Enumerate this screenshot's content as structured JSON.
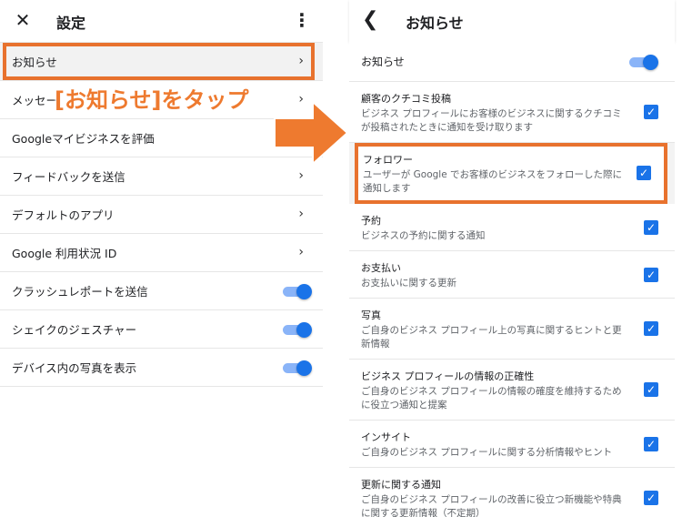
{
  "left": {
    "title": "設定",
    "close_icon": "close-icon",
    "more_icon": "more-vert-icon",
    "rows": [
      {
        "label": "お知らせ",
        "control": "chevron"
      },
      {
        "label": "メッセー",
        "control": "chevron"
      },
      {
        "label": "Googleマイビジネスを評価",
        "control": "none"
      },
      {
        "label": "フィードバックを送信",
        "control": "chevron"
      },
      {
        "label": "デフォルトのアプリ",
        "control": "chevron"
      },
      {
        "label": "Google 利用状況 ID",
        "control": "chevron"
      },
      {
        "label": "クラッシュレポートを送信",
        "control": "toggle-on"
      },
      {
        "label": "シェイクのジェスチャー",
        "control": "toggle-on"
      },
      {
        "label": "デバイス内の写真を表示",
        "control": "toggle-on"
      }
    ],
    "callout": "[お知らせ]をタップ"
  },
  "right": {
    "title": "お知らせ",
    "back_icon": "back-icon",
    "master": {
      "label": "お知らせ",
      "on": true
    },
    "items": [
      {
        "name": "顧客のクチコミ投稿",
        "desc": "ビジネス プロフィールにお客様のビジネスに関するクチコミが投稿されたときに通知を受け取ります",
        "checked": true
      },
      {
        "name": "フォロワー",
        "desc": "ユーザーが Google でお客様のビジネスをフォローした際に通知します",
        "checked": true
      },
      {
        "name": "予約",
        "desc": "ビジネスの予約に関する通知",
        "checked": true
      },
      {
        "name": "お支払い",
        "desc": "お支払いに関する更新",
        "checked": true
      },
      {
        "name": "写真",
        "desc": "ご自身のビジネス プロフィール上の写真に関するヒントと更新情報",
        "checked": true
      },
      {
        "name": "ビジネス プロフィールの情報の正確性",
        "desc": "ご自身のビジネス プロフィールの情報の確度を維持するために役立つ通知と提案",
        "checked": true
      },
      {
        "name": "インサイト",
        "desc": "ご自身のビジネス プロフィールに関する分析情報やヒント",
        "checked": true
      },
      {
        "name": "更新に関する通知",
        "desc": "ご自身のビジネス プロフィールの改善に役立つ新機能や特典に関する更新情報（不定期）",
        "checked": true
      }
    ]
  },
  "colors": {
    "accent": "#1a73e8",
    "highlight": "#e8722e",
    "callout": "#ee7a2f"
  }
}
